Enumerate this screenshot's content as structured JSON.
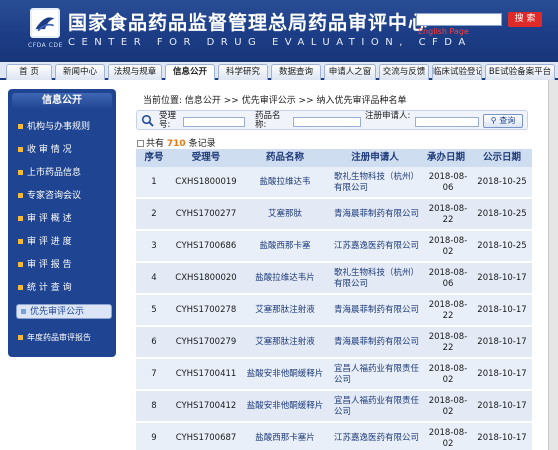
{
  "header": {
    "title": "国家食品药品监督管理总局药品审评中心",
    "subtitle": "CENTER FOR DRUG EVALUATION, CFDA",
    "logo_text": "CFDA CDE",
    "search_button": "搜 索",
    "english_link": "English Page",
    "brand_color": "#1c3d86"
  },
  "nav": {
    "tabs": [
      "首 页",
      "新闻中心",
      "法规与规章",
      "信息公开",
      "科学研究",
      "数据查询",
      "申请人之窗",
      "交流与反馈",
      "临床试验登记",
      "BE试验备案平台"
    ],
    "active_tab": "信息公开"
  },
  "sidebar": {
    "title": "信息公开",
    "items": [
      {
        "label": "机构与办事规则"
      },
      {
        "label": "收 审 情 况"
      },
      {
        "label": "上市药品信息"
      },
      {
        "label": "专家咨询会议"
      },
      {
        "label": "审 评 概 述"
      },
      {
        "label": "审 评 进 度"
      },
      {
        "label": "审 评 报 告"
      },
      {
        "label": "统 计 查 询"
      },
      {
        "label": "优先审评公示"
      },
      {
        "label": "年度药品审评报告"
      }
    ],
    "active_item": "优先审评公示"
  },
  "main": {
    "breadcrumb": "当前位置: 信息公开 >> 优先审评公示 >> 纳入优先审评品种名单",
    "filters": {
      "acceptance_label": "受理号:",
      "drug_name_label": "药品名称:",
      "applicant_label": "注册申请人:",
      "query_button": "查询"
    },
    "record_prefix": "共有",
    "record_count": "710",
    "record_suffix": "条记录",
    "table": {
      "columns": [
        "序号",
        "受理号",
        "药品名称",
        "注册申请人",
        "承办日期",
        "公示日期"
      ],
      "rows": [
        {
          "no": "1",
          "id": "CXHS1800019",
          "drug": "盐酸拉维达韦",
          "applicant": "歌礼生物科技（杭州）有限公司",
          "accept_date": "2018-08-06",
          "notice_date": "2018-10-25"
        },
        {
          "no": "2",
          "id": "CYHS1700277",
          "drug": "艾塞那肽",
          "applicant": "青海晨菲制药有限公司",
          "accept_date": "2018-08-22",
          "notice_date": "2018-10-25"
        },
        {
          "no": "3",
          "id": "CYHS1700686",
          "drug": "盐酸西那卡塞",
          "applicant": "江苏嘉逸医药有限公司",
          "accept_date": "2018-08-02",
          "notice_date": "2018-10-25"
        },
        {
          "no": "4",
          "id": "CXHS1800020",
          "drug": "盐酸拉维达韦片",
          "applicant": "歌礼生物科技（杭州）有限公司",
          "accept_date": "2018-08-06",
          "notice_date": "2018-10-17"
        },
        {
          "no": "5",
          "id": "CYHS1700278",
          "drug": "艾塞那肽注射液",
          "applicant": "青海晨菲制药有限公司",
          "accept_date": "2018-08-22",
          "notice_date": "2018-10-17"
        },
        {
          "no": "6",
          "id": "CYHS1700279",
          "drug": "艾塞那肽注射液",
          "applicant": "青海晨菲制药有限公司",
          "accept_date": "2018-08-22",
          "notice_date": "2018-10-17"
        },
        {
          "no": "7",
          "id": "CYHS1700411",
          "drug": "盐酸安非他酮缓释片",
          "applicant": "宜昌人福药业有限责任公司",
          "accept_date": "2018-08-02",
          "notice_date": "2018-10-17"
        },
        {
          "no": "8",
          "id": "CYHS1700412",
          "drug": "盐酸安非他酮缓释片",
          "applicant": "宜昌人福药业有限责任公司",
          "accept_date": "2018-08-02",
          "notice_date": "2018-10-17"
        },
        {
          "no": "9",
          "id": "CYHS1700687",
          "drug": "盐酸西那卡塞片",
          "applicant": "江苏嘉逸医药有限公司",
          "accept_date": "2018-08-02",
          "notice_date": "2018-10-17"
        }
      ]
    }
  }
}
